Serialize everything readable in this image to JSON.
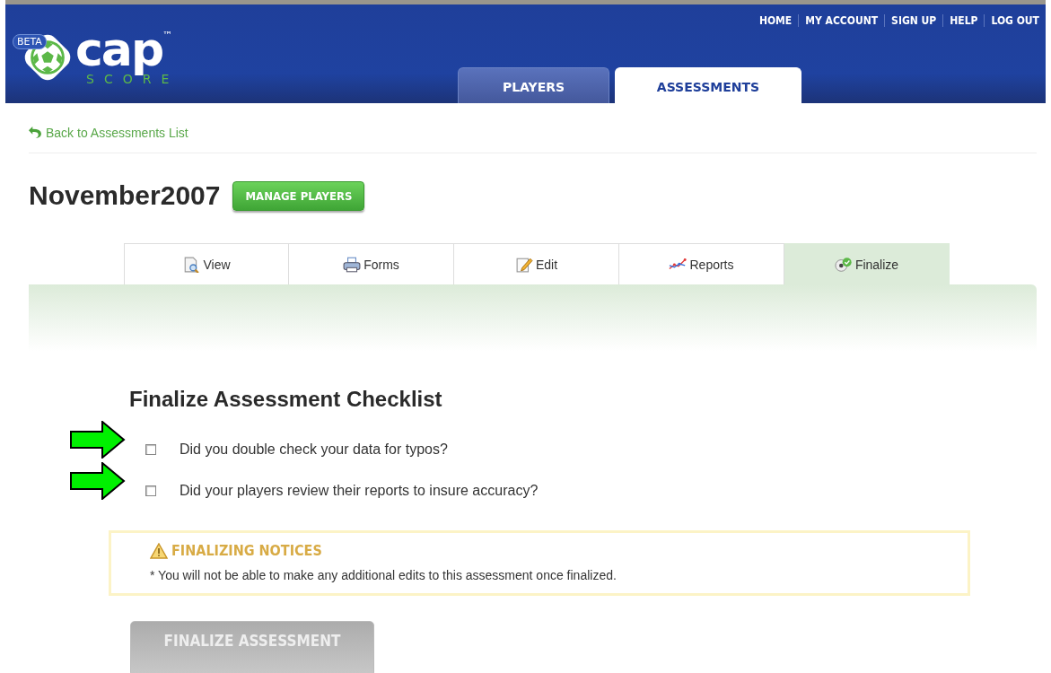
{
  "header": {
    "logo": {
      "badge": "BETA",
      "name": "cap",
      "trademark": "™",
      "tagline": "SCORE"
    },
    "links": [
      "HOME",
      "MY ACCOUNT",
      "SIGN UP",
      "HELP",
      "LOG OUT"
    ],
    "tabs": [
      {
        "label": "PLAYERS",
        "selected": false
      },
      {
        "label": "ASSESSMENTS",
        "selected": true
      }
    ]
  },
  "back_link": "Back to Assessments List",
  "title": "November2007",
  "manage_button": "MANAGE PLAYERS",
  "subtabs": [
    {
      "label": "View",
      "kind": "view",
      "selected": false
    },
    {
      "label": "Forms",
      "kind": "forms",
      "selected": false
    },
    {
      "label": "Edit",
      "kind": "edit",
      "selected": false
    },
    {
      "label": "Reports",
      "kind": "reports",
      "selected": false
    },
    {
      "label": "Finalize",
      "kind": "finalize",
      "selected": true
    }
  ],
  "checklist": {
    "heading": "Finalize Assessment Checklist",
    "items": [
      {
        "label": "Did you double check your data for typos?",
        "checked": false,
        "highlighted": true
      },
      {
        "label": "Did your players review their reports to insure accuracy?",
        "checked": false,
        "highlighted": true
      }
    ]
  },
  "notice": {
    "title": "FINALIZING NOTICES",
    "text": "* You will not be able to make any additional edits to this assessment once finalized."
  },
  "finalize_button": {
    "label": "FINALIZE ASSESSMENT",
    "disabled": true
  }
}
